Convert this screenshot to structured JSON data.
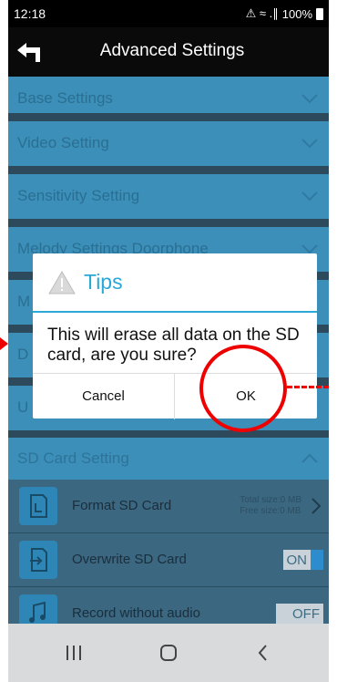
{
  "status_bar": {
    "time": "12:18",
    "signal_indicators": "⚠︎ ≈ .∥",
    "battery_percent": "100%"
  },
  "app_bar": {
    "title": "Advanced Settings",
    "back_icon": "back-arrow-icon"
  },
  "settings_sections": [
    {
      "label": "Base Settings",
      "icon": "chevron-down-icon"
    },
    {
      "label": "Video Setting",
      "icon": "chevron-down-icon"
    },
    {
      "label": "Sensitivity Setting",
      "icon": "chevron-down-icon"
    },
    {
      "label": "Melody Settings Doorphone",
      "icon": "chevron-down-icon"
    },
    {
      "label": "M",
      "icon": "chevron-down-icon"
    },
    {
      "label": "D",
      "icon": "chevron-down-icon"
    },
    {
      "label": "U",
      "icon": "chevron-down-icon"
    }
  ],
  "sd_card": {
    "header": "SD Card Setting",
    "header_icon": "chevron-up-icon",
    "items": [
      {
        "label": "Format SD Card",
        "icon": "format-sd-icon",
        "total_size": "Total size:0 MB",
        "free_size": "Free size:0 MB",
        "trailing_icon": "chevron-right-icon"
      },
      {
        "label": "Overwrite SD Card",
        "icon": "overwrite-sd-icon",
        "toggle": "ON"
      },
      {
        "label": "Record without audio",
        "icon": "music-note-icon",
        "toggle": "OFF"
      }
    ]
  },
  "dialog": {
    "title": "Tips",
    "title_icon": "warning-icon",
    "message": "This will erase all data on the SD card, are you sure?",
    "cancel_label": "Cancel",
    "ok_label": "OK"
  },
  "nav_bar": {
    "recents_icon": "recents-icon",
    "home_icon": "home-icon",
    "back_icon": "nav-back-icon"
  },
  "colors": {
    "section_blue": "#3c8fb8",
    "dialog_accent": "#2aa8d6",
    "annotation_red": "#e00000"
  }
}
